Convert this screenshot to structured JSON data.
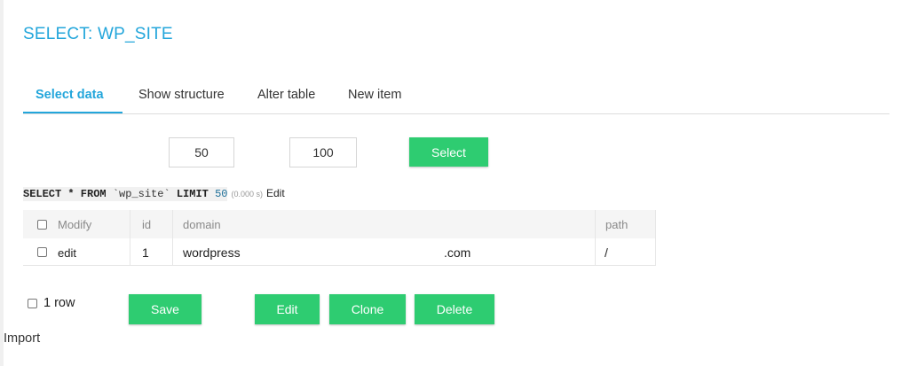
{
  "page": {
    "title": "SELECT: WP_SITE"
  },
  "tabs": [
    {
      "label": "Select data",
      "active": true
    },
    {
      "label": "Show structure",
      "active": false
    },
    {
      "label": "Alter table",
      "active": false
    },
    {
      "label": "New item",
      "active": false
    }
  ],
  "form": {
    "limit_value": "50",
    "text_length_value": "100",
    "select_label": "Select"
  },
  "query": {
    "prefix": "SELECT * FROM ",
    "table": "`wp_site`",
    "limit_keyword": " LIMIT ",
    "limit_number": "50",
    "time": "(0.000 s)",
    "edit_label": "Edit"
  },
  "table": {
    "columns": [
      "Modify",
      "id",
      "domain",
      "path"
    ],
    "rows": [
      {
        "modify": "edit",
        "id": "1",
        "domain_left": "wordpress",
        "domain_right": ".com",
        "path": "/"
      }
    ]
  },
  "footer": {
    "row_count": "1 row",
    "save_label": "Save",
    "edit_label": "Edit",
    "clone_label": "Clone",
    "delete_label": "Delete",
    "import_label": "Import"
  },
  "colors": {
    "accent": "#23a6db",
    "button": "#2ecc71"
  }
}
